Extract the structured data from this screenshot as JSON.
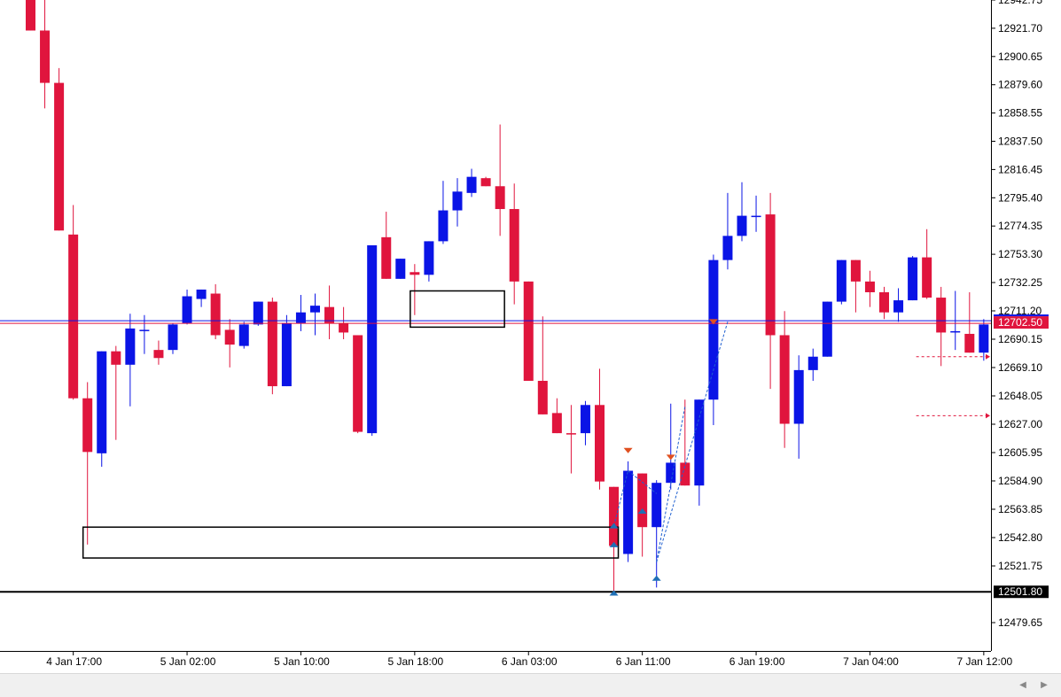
{
  "window": {
    "symbol": "",
    "timeframe": "H1"
  },
  "colors": {
    "bull": "#0a14e6",
    "bear": "#e0153d",
    "ask_line": "#0a14e6",
    "bid_line": "#e0153d",
    "support_line": "#000000",
    "trade_line": "#2060d0",
    "marker_up": "#1f6fb5",
    "marker_down": "#e05020"
  },
  "chart_data": {
    "type": "candlestick",
    "y_ticks": [
      "12942.75",
      "12921.70",
      "12900.65",
      "12879.60",
      "12858.55",
      "12837.50",
      "12816.45",
      "12795.40",
      "12774.35",
      "12753.30",
      "12732.25",
      "12711.20",
      "12690.15",
      "12669.10",
      "12648.05",
      "12627.00",
      "12605.95",
      "12584.90",
      "12563.85",
      "12542.80",
      "12521.75",
      "12479.65"
    ],
    "x_ticks": [
      "4 Jan 17:00",
      "5 Jan 02:00",
      "5 Jan 10:00",
      "5 Jan 18:00",
      "6 Jan 03:00",
      "6 Jan 11:00",
      "6 Jan 19:00",
      "7 Jan 04:00",
      "7 Jan 12:00"
    ],
    "ylim": [
      12465,
      12944
    ],
    "grid": false,
    "current_price": "12702.50",
    "support_price": "12501.80",
    "candles": [
      {
        "o": 12944,
        "h": 12944,
        "l": 12920,
        "c": 12920
      },
      {
        "o": 12920,
        "h": 12944,
        "l": 12862,
        "c": 12881
      },
      {
        "o": 12881,
        "h": 12892,
        "l": 12771,
        "c": 12771
      },
      {
        "o": 12768,
        "h": 12790,
        "l": 12645,
        "c": 12646
      },
      {
        "o": 12646,
        "h": 12658,
        "l": 12537,
        "c": 12606
      },
      {
        "o": 12605,
        "h": 12681,
        "l": 12595,
        "c": 12681
      },
      {
        "o": 12681,
        "h": 12685,
        "l": 12615,
        "c": 12671
      },
      {
        "o": 12671,
        "h": 12709,
        "l": 12640,
        "c": 12698
      },
      {
        "o": 12697,
        "h": 12708,
        "l": 12679,
        "c": 12697
      },
      {
        "o": 12682,
        "h": 12689,
        "l": 12671,
        "c": 12676
      },
      {
        "o": 12682,
        "h": 12702,
        "l": 12679,
        "c": 12701
      },
      {
        "o": 12702,
        "h": 12727,
        "l": 12701,
        "c": 12722
      },
      {
        "o": 12720,
        "h": 12727,
        "l": 12714,
        "c": 12727
      },
      {
        "o": 12724,
        "h": 12731,
        "l": 12690,
        "c": 12693
      },
      {
        "o": 12697,
        "h": 12705,
        "l": 12669,
        "c": 12686
      },
      {
        "o": 12685,
        "h": 12703,
        "l": 12683,
        "c": 12701
      },
      {
        "o": 12701,
        "h": 12711,
        "l": 12700,
        "c": 12718
      },
      {
        "o": 12718,
        "h": 12721,
        "l": 12649,
        "c": 12655
      },
      {
        "o": 12655,
        "h": 12708,
        "l": 12655,
        "c": 12702
      },
      {
        "o": 12702,
        "h": 12723,
        "l": 12696,
        "c": 12710
      },
      {
        "o": 12710,
        "h": 12724,
        "l": 12693,
        "c": 12715
      },
      {
        "o": 12714,
        "h": 12730,
        "l": 12690,
        "c": 12702
      },
      {
        "o": 12702,
        "h": 12714,
        "l": 12690,
        "c": 12695
      },
      {
        "o": 12693,
        "h": 12685,
        "l": 12620,
        "c": 12621
      },
      {
        "o": 12620,
        "h": 12760,
        "l": 12618,
        "c": 12760
      },
      {
        "o": 12766,
        "h": 12785,
        "l": 12735,
        "c": 12735
      },
      {
        "o": 12735,
        "h": 12749,
        "l": 12735,
        "c": 12750
      },
      {
        "o": 12740,
        "h": 12746,
        "l": 12708,
        "c": 12738
      },
      {
        "o": 12738,
        "h": 12758,
        "l": 12733,
        "c": 12763
      },
      {
        "o": 12763,
        "h": 12808,
        "l": 12761,
        "c": 12786
      },
      {
        "o": 12786,
        "h": 12810,
        "l": 12774,
        "c": 12800
      },
      {
        "o": 12799,
        "h": 12817,
        "l": 12796,
        "c": 12811
      },
      {
        "o": 12810,
        "h": 12811,
        "l": 12805,
        "c": 12804
      },
      {
        "o": 12804,
        "h": 12850,
        "l": 12767,
        "c": 12787
      },
      {
        "o": 12787,
        "h": 12806,
        "l": 12716,
        "c": 12733
      },
      {
        "o": 12733,
        "h": 12715,
        "l": 12659,
        "c": 12659
      },
      {
        "o": 12659,
        "h": 12707,
        "l": 12634,
        "c": 12634
      },
      {
        "o": 12635,
        "h": 12646,
        "l": 12620,
        "c": 12620
      },
      {
        "o": 12620,
        "h": 12641,
        "l": 12590,
        "c": 12619
      },
      {
        "o": 12620,
        "h": 12644,
        "l": 12611,
        "c": 12641
      },
      {
        "o": 12641,
        "h": 12668,
        "l": 12578,
        "c": 12584
      },
      {
        "o": 12580,
        "h": 12561,
        "l": 12501,
        "c": 12536
      },
      {
        "o": 12530,
        "h": 12599,
        "l": 12524,
        "c": 12592
      },
      {
        "o": 12590,
        "h": 12576,
        "l": 12528,
        "c": 12550
      },
      {
        "o": 12550,
        "h": 12585,
        "l": 12505,
        "c": 12583
      },
      {
        "o": 12583,
        "h": 12642,
        "l": 12578,
        "c": 12598
      },
      {
        "o": 12598,
        "h": 12645,
        "l": 12594,
        "c": 12581
      },
      {
        "o": 12581,
        "h": 12640,
        "l": 12566,
        "c": 12645
      },
      {
        "o": 12645,
        "h": 12753,
        "l": 12626,
        "c": 12749
      },
      {
        "o": 12749,
        "h": 12799,
        "l": 12742,
        "c": 12767
      },
      {
        "o": 12767,
        "h": 12807,
        "l": 12763,
        "c": 12782
      },
      {
        "o": 12782,
        "h": 12797,
        "l": 12770,
        "c": 12782
      },
      {
        "o": 12783,
        "h": 12799,
        "l": 12653,
        "c": 12693
      },
      {
        "o": 12693,
        "h": 12711,
        "l": 12609,
        "c": 12627
      },
      {
        "o": 12627,
        "h": 12678,
        "l": 12601,
        "c": 12667
      },
      {
        "o": 12667,
        "h": 12683,
        "l": 12659,
        "c": 12677
      },
      {
        "o": 12677,
        "h": 12689,
        "l": 12678,
        "c": 12718
      },
      {
        "o": 12718,
        "h": 12749,
        "l": 12716,
        "c": 12749
      },
      {
        "o": 12749,
        "h": 12747,
        "l": 12710,
        "c": 12733
      },
      {
        "o": 12733,
        "h": 12741,
        "l": 12714,
        "c": 12725
      },
      {
        "o": 12725,
        "h": 12729,
        "l": 12705,
        "c": 12710
      },
      {
        "o": 12710,
        "h": 12728,
        "l": 12703,
        "c": 12719
      },
      {
        "o": 12719,
        "h": 12752,
        "l": 12719,
        "c": 12751
      },
      {
        "o": 12751,
        "h": 12772,
        "l": 12720,
        "c": 12721
      },
      {
        "o": 12721,
        "h": 12729,
        "l": 12670,
        "c": 12695
      },
      {
        "o": 12695,
        "h": 12726,
        "l": 12682,
        "c": 12696
      },
      {
        "o": 12694,
        "h": 12725,
        "l": 12681,
        "c": 12680
      },
      {
        "o": 12680,
        "h": 12705,
        "l": 12674,
        "c": 12701
      }
    ],
    "zones": [
      {
        "x0": 4,
        "x1": 41,
        "top": 12550,
        "bottom": 12527
      },
      {
        "x0": 27,
        "x1": 33,
        "top": 12726,
        "bottom": 12699
      }
    ],
    "trade_lines": [
      {
        "from": [
          41,
          12551
        ],
        "to": [
          42,
          12592
        ]
      },
      {
        "from": [
          42,
          12592
        ],
        "to": [
          44,
          12575
        ]
      },
      {
        "from": [
          44,
          12524
        ],
        "to": [
          46,
          12640
        ]
      },
      {
        "from": [
          44,
          12524
        ],
        "to": [
          49,
          12703
        ]
      }
    ],
    "markers": [
      {
        "i": 41,
        "price": 12501,
        "dir": "up"
      },
      {
        "i": 41,
        "price": 12537,
        "dir": "up"
      },
      {
        "i": 41,
        "price": 12551,
        "dir": "up"
      },
      {
        "i": 42,
        "price": 12607,
        "dir": "down"
      },
      {
        "i": 43,
        "price": 12562,
        "dir": "up"
      },
      {
        "i": 44,
        "price": 12512,
        "dir": "up"
      },
      {
        "i": 45,
        "price": 12602,
        "dir": "down"
      },
      {
        "i": 48,
        "price": 12703,
        "dir": "down"
      }
    ],
    "pending_orders": [
      {
        "price": 12677,
        "from": 63
      },
      {
        "price": 12633,
        "from": 63
      }
    ]
  }
}
